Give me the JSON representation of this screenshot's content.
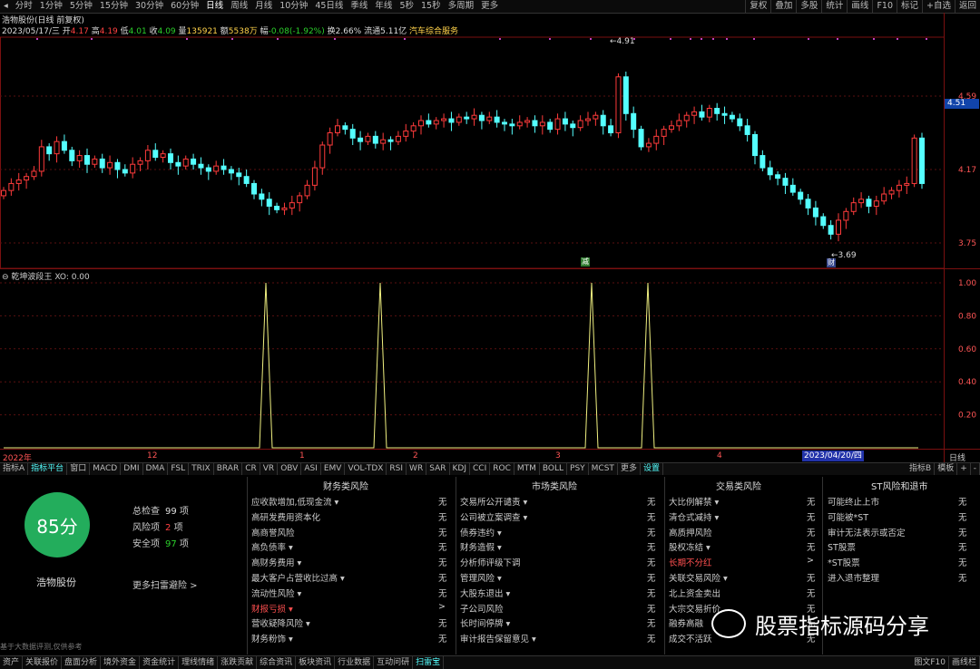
{
  "toolbar": {
    "periods": [
      "分时",
      "1分钟",
      "5分钟",
      "15分钟",
      "30分钟",
      "60分钟",
      "日线",
      "周线",
      "月线",
      "10分钟",
      "45日线",
      "季线",
      "年线",
      "5秒",
      "15秒",
      "多周期",
      "更多"
    ],
    "active_period": "日线",
    "right": [
      "复权",
      "叠加",
      "多股",
      "统计",
      "画线",
      "F10",
      "标记",
      "+自选",
      "返回"
    ]
  },
  "info": {
    "title": "浩物股份(日线 前复权)",
    "date": "2023/05/17/三",
    "open_label": "开",
    "open": "4.17",
    "high_label": "高",
    "high": "4.19",
    "low_label": "低",
    "low": "4.01",
    "close_label": "收",
    "close": "4.09",
    "vol_label": "量",
    "vol": "135921",
    "amt_label": "额",
    "amt": "5538万",
    "chg_label": "幅",
    "chg": "-0.08(-1.92%)",
    "turn_label": "换",
    "turn": "2.66%",
    "float_label": "流通",
    "float": "5.11亿",
    "sector": "汽车综合服务"
  },
  "price_axis": {
    "labels": [
      "4.59",
      "4.17",
      "3.75"
    ],
    "current": "4.51",
    "peak": "4.91",
    "low": "3.69"
  },
  "marker_jian": "减",
  "marker_cai": "财",
  "indicator": {
    "name": "乾坤波段王",
    "xo": "XO: 0.00",
    "axis": [
      "1.00",
      "0.80",
      "0.60",
      "0.40",
      "0.20"
    ]
  },
  "time_axis": {
    "labels": [
      "2022年",
      "12",
      "1",
      "2",
      "3",
      "4"
    ],
    "cursor": "2023/04/20/四",
    "period": "日线"
  },
  "tabs": {
    "items": [
      "指标A",
      "指标平台",
      "窗口",
      "MACD",
      "DMI",
      "DMA",
      "FSL",
      "TRIX",
      "BRAR",
      "CR",
      "VR",
      "OBV",
      "ASI",
      "EMV",
      "VOL-TDX",
      "RSI",
      "WR",
      "SAR",
      "KDJ",
      "CCI",
      "ROC",
      "MTM",
      "BOLL",
      "PSY",
      "MCST",
      "更多",
      "设置"
    ],
    "right": [
      "指标B",
      "模板",
      "+",
      "-"
    ]
  },
  "risk": {
    "score": "85分",
    "stock_name": "浩物股份",
    "total_label": "总检查",
    "total": "99",
    "total_unit": "项",
    "risk_label": "风险项",
    "risk_count": "2",
    "risk_unit": "项",
    "safe_label": "安全项",
    "safe": "97",
    "safe_unit": "项",
    "more": "更多扫雷避险 >",
    "disclaimer": "基于大数据评测,仅供参考"
  },
  "columns": [
    {
      "title": "财务类风险",
      "rows": [
        {
          "label": "应收款增加,低现金流 ▾",
          "val": "无"
        },
        {
          "label": "高研发费用资本化",
          "val": "无"
        },
        {
          "label": "高商誉风险",
          "val": "无"
        },
        {
          "label": "高负债率 ▾",
          "val": "无"
        },
        {
          "label": "高财务费用 ▾",
          "val": "无"
        },
        {
          "label": "最大客户占营收比过高 ▾",
          "val": "无"
        },
        {
          "label": "流动性风险 ▾",
          "val": "无"
        },
        {
          "label": "财报亏损 ▾",
          "val": ">",
          "hl": true
        },
        {
          "label": "营收疑降风险 ▾",
          "val": "无"
        },
        {
          "label": "财务粉饰 ▾",
          "val": "无"
        }
      ]
    },
    {
      "title": "市场类风险",
      "rows": [
        {
          "label": "交易所公开谴责 ▾",
          "val": "无"
        },
        {
          "label": "公司被立案调查 ▾",
          "val": "无"
        },
        {
          "label": "债券违约 ▾",
          "val": "无"
        },
        {
          "label": "财务造假 ▾",
          "val": "无"
        },
        {
          "label": "分析师评级下调",
          "val": "无"
        },
        {
          "label": "管理风险 ▾",
          "val": "无"
        },
        {
          "label": "大股东退出 ▾",
          "val": "无"
        },
        {
          "label": "子公司风险",
          "val": "无"
        },
        {
          "label": "长时间停牌 ▾",
          "val": "无"
        },
        {
          "label": "审计报告保留意见 ▾",
          "val": "无"
        }
      ]
    },
    {
      "title": "交易类风险",
      "rows": [
        {
          "label": "大比例解禁 ▾",
          "val": "无"
        },
        {
          "label": "清仓式减持 ▾",
          "val": "无"
        },
        {
          "label": "高质押风险",
          "val": "无"
        },
        {
          "label": "股权冻结 ▾",
          "val": "无"
        },
        {
          "label": "长期不分红",
          "val": ">",
          "hl": true
        },
        {
          "label": "关联交易风险 ▾",
          "val": "无"
        },
        {
          "label": "北上资金卖出",
          "val": "无"
        },
        {
          "label": "大宗交易折价",
          "val": "无"
        },
        {
          "label": "融券高融",
          "val": "无"
        },
        {
          "label": "成交不活跃",
          "val": "无"
        }
      ]
    },
    {
      "title": "ST风险和退市",
      "rows": [
        {
          "label": "可能终止上市",
          "val": "无"
        },
        {
          "label": "可能被*ST",
          "val": "无"
        },
        {
          "label": "审计无法表示或否定",
          "val": "无"
        },
        {
          "label": "ST股票",
          "val": "无"
        },
        {
          "label": "*ST股票",
          "val": "无"
        },
        {
          "label": "进入退市整理",
          "val": "无"
        }
      ]
    }
  ],
  "bottom": {
    "items": [
      "资产",
      "关联报价",
      "盘面分析",
      "境外资金",
      "资金统计",
      "理线情绪",
      "涨跌贡献",
      "综合资讯",
      "板块资讯",
      "行业数据",
      "互动问研",
      "扫雷宝"
    ],
    "active": "扫雷宝",
    "right": [
      "图文F10",
      "画线栏"
    ]
  },
  "watermark": "股票指标源码分享"
}
